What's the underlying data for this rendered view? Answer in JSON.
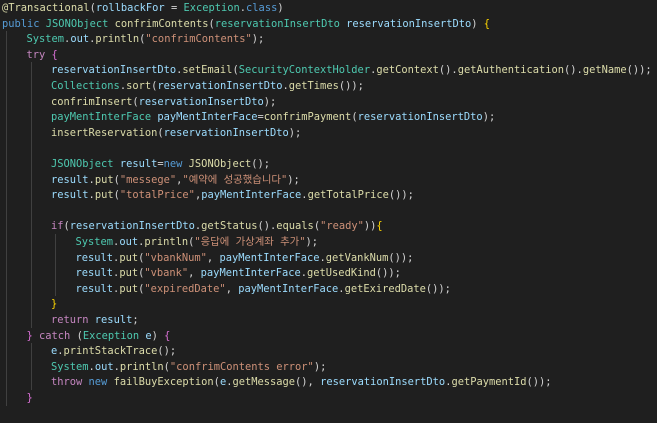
{
  "editor": {
    "language": "java",
    "theme_background": "#1f1f1f",
    "colors": {
      "keyword": "#569cd6",
      "control_keyword": "#c586c0",
      "type": "#4ec9b0",
      "function": "#dcdcaa",
      "variable": "#9cdcfe",
      "string": "#ce9178",
      "plain": "#d4d4d4"
    },
    "lines": [
      {
        "indent": 0,
        "tokens": [
          [
            "anno",
            "@Transactional"
          ],
          [
            "plain",
            "("
          ],
          [
            "var",
            "rollbackFor"
          ],
          [
            "plain",
            " = "
          ],
          [
            "ty",
            "Exception"
          ],
          [
            "plain",
            "."
          ],
          [
            "kw",
            "class"
          ],
          [
            "plain",
            ")"
          ]
        ]
      },
      {
        "indent": 0,
        "tokens": [
          [
            "kw",
            "public "
          ],
          [
            "ty",
            "JSONObject "
          ],
          [
            "fn",
            "confrimContents"
          ],
          [
            "plain",
            "("
          ],
          [
            "ty",
            "reservationInsertDto "
          ],
          [
            "var",
            "reservationInsertDto"
          ],
          [
            "plain",
            ") "
          ],
          [
            "brace",
            "{"
          ]
        ]
      },
      {
        "indent": 1,
        "tokens": [
          [
            "ty",
            "System"
          ],
          [
            "plain",
            "."
          ],
          [
            "var",
            "out"
          ],
          [
            "plain",
            "."
          ],
          [
            "fn",
            "println"
          ],
          [
            "plain",
            "("
          ],
          [
            "str",
            "\"confrimContents\""
          ],
          [
            "plain",
            ");"
          ]
        ]
      },
      {
        "indent": 1,
        "tokens": [
          [
            "ctl",
            "try "
          ],
          [
            "brace2",
            "{"
          ]
        ]
      },
      {
        "indent": 2,
        "tokens": [
          [
            "var",
            "reservationInsertDto"
          ],
          [
            "plain",
            "."
          ],
          [
            "fn",
            "setEmail"
          ],
          [
            "plain",
            "("
          ],
          [
            "ty",
            "SecurityContextHolder"
          ],
          [
            "plain",
            "."
          ],
          [
            "fn",
            "getContext"
          ],
          [
            "plain",
            "()."
          ],
          [
            "fn",
            "getAuthentication"
          ],
          [
            "plain",
            "()."
          ],
          [
            "fn",
            "getName"
          ],
          [
            "plain",
            "());"
          ]
        ]
      },
      {
        "indent": 2,
        "tokens": [
          [
            "ty",
            "Collections"
          ],
          [
            "plain",
            "."
          ],
          [
            "fn",
            "sort"
          ],
          [
            "plain",
            "("
          ],
          [
            "var",
            "reservationInsertDto"
          ],
          [
            "plain",
            "."
          ],
          [
            "fn",
            "getTimes"
          ],
          [
            "plain",
            "());"
          ]
        ]
      },
      {
        "indent": 2,
        "tokens": [
          [
            "fn",
            "confrimInsert"
          ],
          [
            "plain",
            "("
          ],
          [
            "var",
            "reservationInsertDto"
          ],
          [
            "plain",
            ");"
          ]
        ]
      },
      {
        "indent": 2,
        "tokens": [
          [
            "ty",
            "payMentInterFace "
          ],
          [
            "var",
            "payMentInterFace"
          ],
          [
            "plain",
            "="
          ],
          [
            "fn",
            "confrimPayment"
          ],
          [
            "plain",
            "("
          ],
          [
            "var",
            "reservationInsertDto"
          ],
          [
            "plain",
            ");"
          ]
        ]
      },
      {
        "indent": 2,
        "tokens": [
          [
            "fn",
            "insertReservation"
          ],
          [
            "plain",
            "("
          ],
          [
            "var",
            "reservationInsertDto"
          ],
          [
            "plain",
            ");"
          ]
        ]
      },
      {
        "indent": 2,
        "tokens": []
      },
      {
        "indent": 2,
        "tokens": [
          [
            "ty",
            "JSONObject "
          ],
          [
            "var",
            "result"
          ],
          [
            "plain",
            "="
          ],
          [
            "kw",
            "new "
          ],
          [
            "fn",
            "JSONObject"
          ],
          [
            "plain",
            "();"
          ]
        ]
      },
      {
        "indent": 2,
        "tokens": [
          [
            "var",
            "result"
          ],
          [
            "plain",
            "."
          ],
          [
            "fn",
            "put"
          ],
          [
            "plain",
            "("
          ],
          [
            "str",
            "\"messege\""
          ],
          [
            "plain",
            ","
          ],
          [
            "str",
            "\"예약에 성공했습니다\""
          ],
          [
            "plain",
            ");"
          ]
        ]
      },
      {
        "indent": 2,
        "tokens": [
          [
            "var",
            "result"
          ],
          [
            "plain",
            "."
          ],
          [
            "fn",
            "put"
          ],
          [
            "plain",
            "("
          ],
          [
            "str",
            "\"totalPrice\""
          ],
          [
            "plain",
            ","
          ],
          [
            "var",
            "payMentInterFace"
          ],
          [
            "plain",
            "."
          ],
          [
            "fn",
            "getTotalPrice"
          ],
          [
            "plain",
            "());"
          ]
        ]
      },
      {
        "indent": 2,
        "tokens": []
      },
      {
        "indent": 2,
        "tokens": [
          [
            "ctl",
            "if"
          ],
          [
            "plain",
            "("
          ],
          [
            "var",
            "reservationInsertDto"
          ],
          [
            "plain",
            "."
          ],
          [
            "fn",
            "getStatus"
          ],
          [
            "plain",
            "()."
          ],
          [
            "fn",
            "equals"
          ],
          [
            "plain",
            "("
          ],
          [
            "str",
            "\"ready\""
          ],
          [
            "plain",
            "))"
          ],
          [
            "brace",
            "{"
          ]
        ]
      },
      {
        "indent": 3,
        "tokens": [
          [
            "ty",
            "System"
          ],
          [
            "plain",
            "."
          ],
          [
            "var",
            "out"
          ],
          [
            "plain",
            "."
          ],
          [
            "fn",
            "println"
          ],
          [
            "plain",
            "("
          ],
          [
            "str",
            "\"응답에 가상계좌 추가\""
          ],
          [
            "plain",
            ");"
          ]
        ]
      },
      {
        "indent": 3,
        "tokens": [
          [
            "var",
            "result"
          ],
          [
            "plain",
            "."
          ],
          [
            "fn",
            "put"
          ],
          [
            "plain",
            "("
          ],
          [
            "str",
            "\"vbankNum\""
          ],
          [
            "plain",
            ", "
          ],
          [
            "var",
            "payMentInterFace"
          ],
          [
            "plain",
            "."
          ],
          [
            "fn",
            "getVankNum"
          ],
          [
            "plain",
            "());"
          ]
        ]
      },
      {
        "indent": 3,
        "tokens": [
          [
            "var",
            "result"
          ],
          [
            "plain",
            "."
          ],
          [
            "fn",
            "put"
          ],
          [
            "plain",
            "("
          ],
          [
            "str",
            "\"vbank\""
          ],
          [
            "plain",
            ", "
          ],
          [
            "var",
            "payMentInterFace"
          ],
          [
            "plain",
            "."
          ],
          [
            "fn",
            "getUsedKind"
          ],
          [
            "plain",
            "());"
          ]
        ]
      },
      {
        "indent": 3,
        "tokens": [
          [
            "var",
            "result"
          ],
          [
            "plain",
            "."
          ],
          [
            "fn",
            "put"
          ],
          [
            "plain",
            "("
          ],
          [
            "str",
            "\"expiredDate\""
          ],
          [
            "plain",
            ", "
          ],
          [
            "var",
            "payMentInterFace"
          ],
          [
            "plain",
            "."
          ],
          [
            "fn",
            "getExiredDate"
          ],
          [
            "plain",
            "());"
          ]
        ]
      },
      {
        "indent": 2,
        "tokens": [
          [
            "brace",
            "}"
          ]
        ]
      },
      {
        "indent": 2,
        "tokens": [
          [
            "ctl",
            "return "
          ],
          [
            "var",
            "result"
          ],
          [
            "plain",
            ";"
          ]
        ]
      },
      {
        "indent": 1,
        "tokens": [
          [
            "brace2",
            "} "
          ],
          [
            "ctl",
            "catch "
          ],
          [
            "plain",
            "("
          ],
          [
            "ty",
            "Exception "
          ],
          [
            "var",
            "e"
          ],
          [
            "plain",
            ") "
          ],
          [
            "brace2",
            "{"
          ]
        ]
      },
      {
        "indent": 2,
        "tokens": [
          [
            "var",
            "e"
          ],
          [
            "plain",
            "."
          ],
          [
            "fn",
            "printStackTrace"
          ],
          [
            "plain",
            "();"
          ]
        ]
      },
      {
        "indent": 2,
        "tokens": [
          [
            "ty",
            "System"
          ],
          [
            "plain",
            "."
          ],
          [
            "var",
            "out"
          ],
          [
            "plain",
            "."
          ],
          [
            "fn",
            "println"
          ],
          [
            "plain",
            "("
          ],
          [
            "str",
            "\"confrimContents error\""
          ],
          [
            "plain",
            ");"
          ]
        ]
      },
      {
        "indent": 2,
        "tokens": [
          [
            "ctl",
            "throw "
          ],
          [
            "kw",
            "new "
          ],
          [
            "fn",
            "failBuyException"
          ],
          [
            "plain",
            "("
          ],
          [
            "var",
            "e"
          ],
          [
            "plain",
            "."
          ],
          [
            "fn",
            "getMessage"
          ],
          [
            "plain",
            "(), "
          ],
          [
            "var",
            "reservationInsertDto"
          ],
          [
            "plain",
            "."
          ],
          [
            "fn",
            "getPaymentId"
          ],
          [
            "plain",
            "());"
          ]
        ]
      },
      {
        "indent": 1,
        "tokens": [
          [
            "brace2",
            "}"
          ]
        ]
      },
      {
        "indent": 0,
        "tokens": []
      },
      {
        "indent": 0,
        "tokens": [
          [
            "brace",
            "}"
          ]
        ]
      }
    ]
  }
}
